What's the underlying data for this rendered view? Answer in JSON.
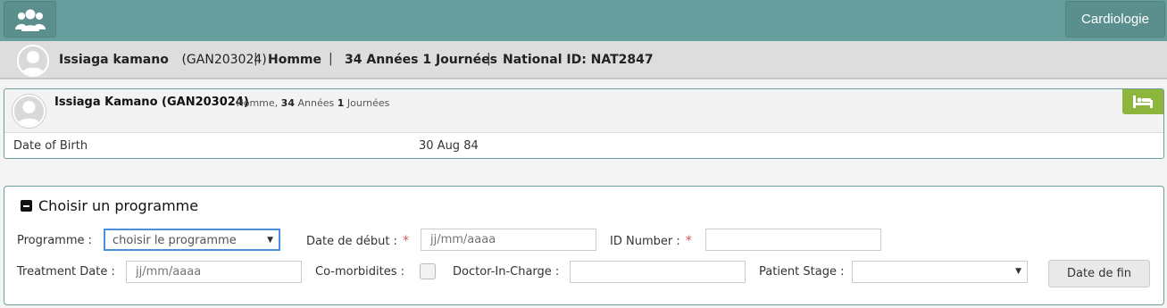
{
  "topbar": {
    "home_icon": "users-group-icon",
    "department_label": "Cardiologie"
  },
  "patient_strip": {
    "name": "Issiaga kamano",
    "id": "(GAN203024)",
    "gender": "Homme",
    "age": "34 Années 1 Journées",
    "national_id": "National ID: NAT2847"
  },
  "patient_card": {
    "name": "Issiaga Kamano (GAN203024)",
    "meta_prefix": "- Homme,",
    "age_years": "34",
    "age_years_unit": "Années",
    "age_days": "1",
    "age_days_unit": "Journées",
    "bed_icon": "bed-icon",
    "bed_color": "#8cb63c",
    "dob_label": "Date of Birth",
    "dob_value": "30 Aug 84"
  },
  "program_form": {
    "title": "Choisir un programme",
    "programme_label": "Programme :",
    "programme_value": "choisir le programme",
    "start_date_label": "Date de début :",
    "start_date_placeholder": "jj/mm/aaaa",
    "id_number_label": "ID Number :",
    "id_number_value": "",
    "treatment_date_label": "Treatment Date :",
    "treatment_date_placeholder": "jj/mm/aaaa",
    "comorbidities_label": "Co-morbidites :",
    "doctor_label": "Doctor-In-Charge :",
    "doctor_value": "",
    "stage_label": "Patient Stage :",
    "stage_value": "",
    "end_date_button": "Date de fin",
    "required_mark": "*"
  },
  "colors": {
    "topbar": "#669e9d",
    "accent_border": "#6c9e9d",
    "required": "#d9534f"
  }
}
